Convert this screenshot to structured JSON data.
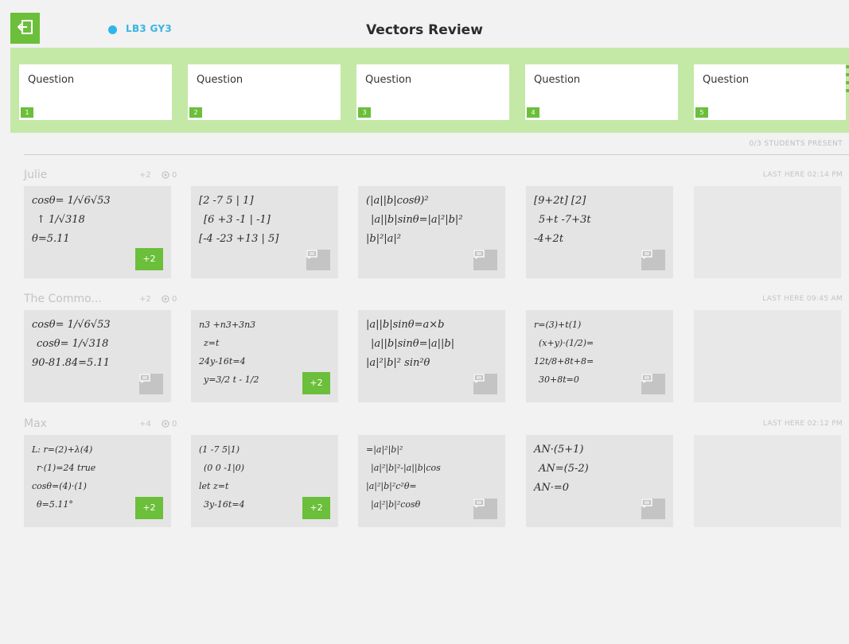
{
  "header": {
    "class_code": "LB3 GY3",
    "title": "Vectors Review"
  },
  "questions": [
    {
      "label": "Question",
      "number": "1"
    },
    {
      "label": "Question",
      "number": "2"
    },
    {
      "label": "Question",
      "number": "3"
    },
    {
      "label": "Question",
      "number": "4"
    },
    {
      "label": "Question",
      "number": "5"
    }
  ],
  "attendance": "0/3 STUDENTS PRESENT",
  "students": [
    {
      "name": "Julie",
      "score": "+2",
      "count": "0",
      "last_here": "LAST HERE 02:14 PM",
      "tiles": [
        {
          "badge": "+2",
          "lines": [
            "cosθ= 1/√6√53",
            "↑  1/√318",
            "θ=5.11"
          ]
        },
        {
          "badge": "chat",
          "lines": [
            "[2 -7 5 | 1]",
            "[6 +3 -1 | -1]",
            "[-4 -23 +13 | 5]"
          ]
        },
        {
          "badge": "chat",
          "lines": [
            "(|a||b|cosθ)²",
            "|a||b|sinθ=|a|²|b|²",
            "|b|²|a|²"
          ]
        },
        {
          "badge": "chat",
          "lines": [
            "[9+2t] [2]",
            "5+t  -7+3t",
            "-4+2t"
          ]
        },
        {
          "badge": "",
          "lines": []
        }
      ]
    },
    {
      "name": "The Commo...",
      "score": "+2",
      "count": "0",
      "last_here": "LAST HERE 09:45 AM",
      "tiles": [
        {
          "badge": "chat",
          "lines": [
            "cosθ= 1/√6√53",
            "cosθ= 1/√318",
            "90-81.84=5.11"
          ]
        },
        {
          "badge": "+2",
          "lines": [
            "n3 +n3+3n3",
            "z=t",
            "24y-16t=4",
            "y=3/2 t - 1/2"
          ]
        },
        {
          "badge": "chat",
          "lines": [
            "|a||b|sinθ=a×b",
            "|a||b|sinθ=|a||b|",
            "|a|²|b|² sin²θ"
          ]
        },
        {
          "badge": "chat",
          "lines": [
            "r=(3)+t(1)",
            "(x+y)·(1/2)=",
            "12t/8+8t+8=",
            "30+8t=0"
          ]
        },
        {
          "badge": "",
          "lines": []
        }
      ]
    },
    {
      "name": "Max",
      "score": "+4",
      "count": "0",
      "last_here": "LAST HERE 02:12 PM",
      "tiles": [
        {
          "badge": "+2",
          "lines": [
            "L: r=(2)+λ(4)",
            "r·(1)=24  true",
            "cosθ=(4)·(1)",
            "θ=5.11°"
          ]
        },
        {
          "badge": "+2",
          "lines": [
            "(1 -7 5|1)",
            "(0 0 -1|0)",
            "let z=t",
            "3y-16t=4"
          ]
        },
        {
          "badge": "chat",
          "lines": [
            "=|a|²|b|²",
            "|a|²|b|²-|a||b|cos",
            "|a|²|b|²c²θ=",
            "|a|²|b|²cosθ"
          ]
        },
        {
          "badge": "chat",
          "lines": [
            "AN·(5+1)",
            "AN=(5-2)",
            "AN·=0"
          ]
        },
        {
          "badge": "",
          "lines": []
        }
      ]
    }
  ]
}
